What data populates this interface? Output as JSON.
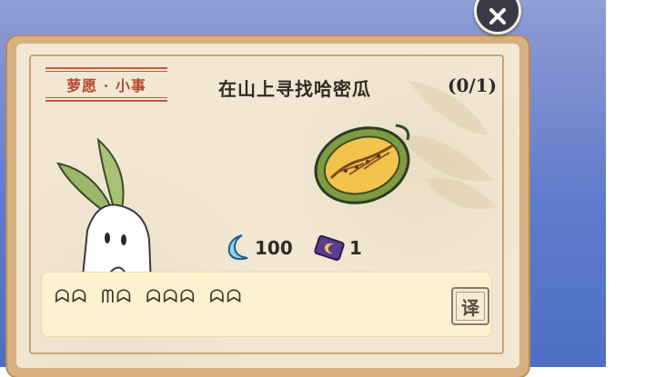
{
  "close_button": {
    "icon": "close-icon"
  },
  "quest": {
    "tag": "萝愿 · 小事",
    "title": "在山上寻找哈密瓜",
    "progress": "(0/1)",
    "item_icon": "cantaloupe-icon",
    "npc_icon": "radish-npc"
  },
  "rewards": [
    {
      "icon": "moon-currency-icon",
      "amount": "100",
      "color": "#8fd3f0"
    },
    {
      "icon": "moon-ticket-icon",
      "amount": "1",
      "color": "#5b3d8e"
    }
  ],
  "dialog": {
    "text": "ᗣᗣ ᗰᗣ ᗣᗣᗣ ᗣᗣ",
    "translate_label": "译"
  }
}
